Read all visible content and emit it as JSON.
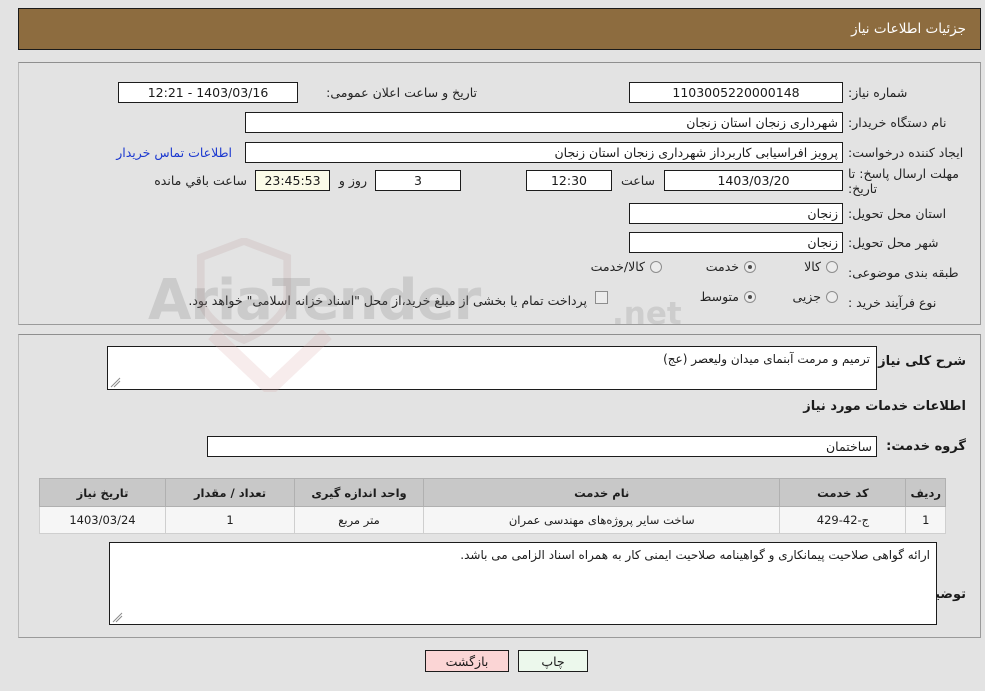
{
  "header": {
    "title": "جزئیات اطلاعات نیاز"
  },
  "form": {
    "need_number_label": "شماره نیاز:",
    "need_number_value": "1103005220000148",
    "buyer_org_label": "نام دستگاه خریدار:",
    "buyer_org_value": "شهرداری زنجان استان زنجان",
    "creator_label": "ایجاد کننده درخواست:",
    "creator_value": "پرویز افراسیابی کاربرداز شهرداری زنجان استان زنجان",
    "deadline_label": "مهلت ارسال پاسخ: تا تاریخ:",
    "deadline_date": "1403/03/20",
    "deadline_hour_label": "ساعت",
    "deadline_hour": "12:30",
    "province_label": "استان محل تحویل:",
    "province_value": "زنجان",
    "city_label": "شهر محل تحویل:",
    "city_value": "زنجان",
    "category_label": "طبقه بندی موضوعی:",
    "process_label": "نوع فرآیند خرید :",
    "announce_label": "تاریخ و ساعت اعلان عمومی:",
    "announce_value": "1403/03/16 - 12:21",
    "contact_link": "اطلاعات تماس خریدار",
    "remaining_days": "3",
    "remaining_days_label": "روز و",
    "remaining_time": "23:45:53",
    "remaining_time_label": "ساعت باقي مانده",
    "treasury_checkbox_label": "پرداخت تمام یا بخشی از مبلغ خرید،از محل \"اسناد خزانه اسلامی\" خواهد بود."
  },
  "category_options": [
    {
      "label": "کالا",
      "selected": false
    },
    {
      "label": "خدمت",
      "selected": true
    },
    {
      "label": "کالا/خدمت",
      "selected": false
    }
  ],
  "process_options": [
    {
      "label": "جزیی",
      "selected": false
    },
    {
      "label": "متوسط",
      "selected": true
    }
  ],
  "details": {
    "general_desc_label": "شرح کلی نیاز:",
    "general_desc_value": "ترمیم و مرمت آبنمای  میدان ولیعصر  (عج)",
    "services_section_title": "اطلاعات خدمات مورد نیاز",
    "service_group_label": "گروه خدمت:",
    "service_group_value": "ساختمان",
    "buyer_notes_label": "توضیحات خریدار:",
    "buyer_notes_value": "ارائه گواهی صلاحیت پیمانکاری و گواهینامه صلاحیت ایمنی کار به همراه اسناد الزامی می باشد."
  },
  "table": {
    "headers": [
      "ردیف",
      "کد خدمت",
      "نام خدمت",
      "واحد اندازه گیری",
      "تعداد / مقدار",
      "تاریخ نیاز"
    ],
    "rows": [
      [
        "1",
        "ج-42-429",
        "ساخت سایر پروژه‌های مهندسی عمران",
        "متر مربع",
        "1",
        "1403/03/24"
      ]
    ]
  },
  "buttons": {
    "print": "چاپ",
    "back": "بازگشت"
  },
  "watermark": {
    "text": "AriaTender",
    "suffix": ".net"
  },
  "colors": {
    "header_brown": "#8d6c3f",
    "page_bg": "#e3e3e3",
    "link_blue": "#1b38d0",
    "back_btn": "#fbd5d5",
    "print_btn": "#ecf8ec",
    "timer_bg": "#fbfbe8"
  }
}
